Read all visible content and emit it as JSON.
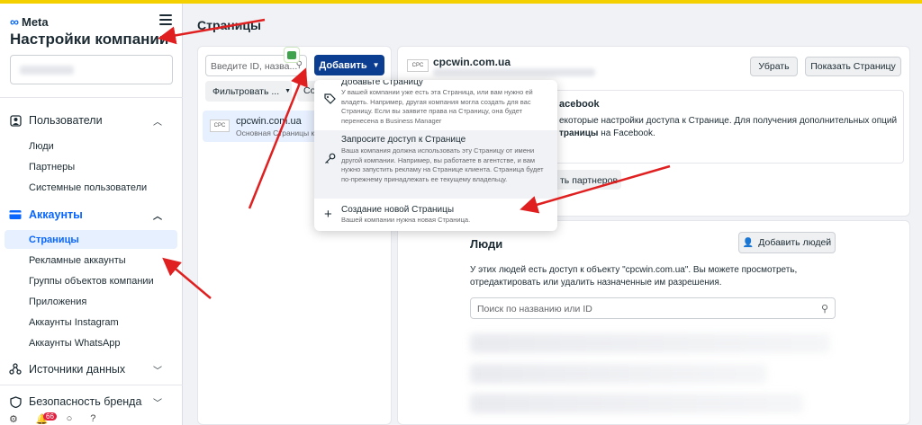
{
  "brand": {
    "logo_text": "Meta"
  },
  "sidebar": {
    "title": "Настройки компании",
    "sections": [
      {
        "label": "Пользователи",
        "items": [
          "Люди",
          "Партнеры",
          "Системные пользователи"
        ]
      },
      {
        "label": "Аккаунты",
        "items": [
          "Страницы",
          "Рекламные аккаунты",
          "Группы объектов компании",
          "Приложения",
          "Аккаунты Instagram",
          "Аккаунты WhatsApp"
        ]
      },
      {
        "label": "Источники данных"
      },
      {
        "label": "Безопасность бренда"
      }
    ],
    "selected_item": "Страницы",
    "notification_count": "66"
  },
  "main": {
    "title": "Страницы",
    "search_placeholder": "Введите ID, назва...",
    "add_button": "Добавить",
    "filter_button": "Фильтровать ...",
    "filter_button_2": "Со",
    "page_item": {
      "name": "cpcwin.com.ua",
      "subtitle": "Основная Страницы ко",
      "logo": "CPC"
    }
  },
  "dropdown": {
    "items": [
      {
        "title": "Добавьте Страницу",
        "desc": "У вашей компании уже есть эта Страница, или вам нужно ей владеть. Например, другая компания могла создать для вас Страницу. Если вы заявите права на Страницу, она будет перенесена в Business Manager"
      },
      {
        "title": "Запросите доступ к Странице",
        "desc": "Ваша компания должна использовать эту Страницу от имени другой компании. Например, вы работаете в агентстве, и вам нужно запустить рекламу на Странице клиента. Страница будет по-прежнему принадлежать ее текущему владельцу."
      },
      {
        "title": "Создание новой Страницы",
        "desc": "Вашей компании нужна новая Страница."
      }
    ]
  },
  "detail": {
    "page_name": "cpcwin.com.ua",
    "logo": "CPC",
    "remove_button": "Убрать",
    "show_button": "Показать Страницу",
    "notice_title": "acebook",
    "notice_text_1": "екоторые настройки доступа к Странице. Для получения дополнительных опций",
    "notice_text_2_bold": "траницы",
    "notice_text_2_rest": " на Facebook.",
    "partners_button": "ть партнеров"
  },
  "people": {
    "title": "Люди",
    "add_button": "Добавить людей",
    "desc_1": "У этих людей есть доступ к объекту \"cpcwin.com.ua\". Вы можете просмотреть,",
    "desc_2": "отредактировать или удалить назначенные им разрешения.",
    "search_placeholder": "Поиск по названию или ID"
  },
  "colors": {
    "accent": "#0866ff",
    "add_button_bg": "#0b3e91",
    "arrow": "#e02020",
    "topbar": "#f5d000"
  }
}
